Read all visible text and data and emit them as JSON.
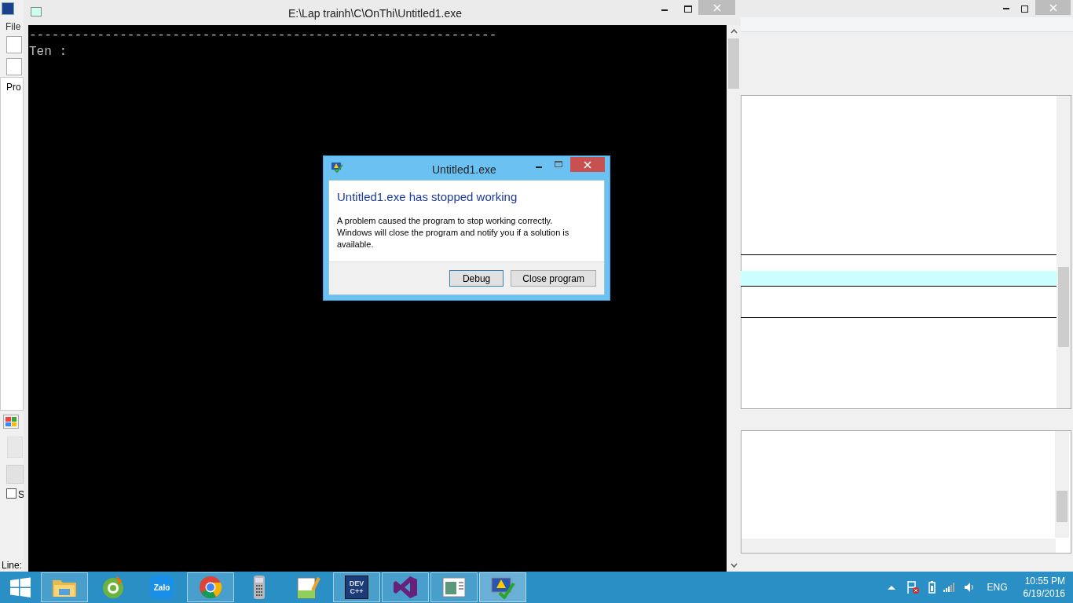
{
  "ide": {
    "menu": [
      "File"
    ],
    "panel_tab": "Pro",
    "checkbox_label": "S",
    "checkbox_checked": false,
    "status": "Line:"
  },
  "console": {
    "title": "E:\\Lap trainh\\C\\OnThi\\Untitled1.exe",
    "lines": [
      "--------------------------------------------------------------",
      "Ten :"
    ]
  },
  "dialog": {
    "title": "Untitled1.exe",
    "heading": "Untitled1.exe has stopped working",
    "message": "A problem caused the program to stop working correctly. Windows will close the program and notify you if a solution is available.",
    "buttons": [
      {
        "label": "Debug",
        "selected": true
      },
      {
        "label": "Close program",
        "selected": false
      }
    ]
  },
  "taskbar": {
    "apps": [
      {
        "kind": "folder",
        "running": true,
        "selected": false
      },
      {
        "kind": "browser-leaf",
        "running": false,
        "selected": false
      },
      {
        "kind": "chat",
        "label": "Zalo",
        "running": false,
        "selected": false
      },
      {
        "kind": "chrome",
        "running": true,
        "selected": false
      },
      {
        "kind": "calculator",
        "running": false,
        "selected": false
      },
      {
        "kind": "notepad",
        "running": false,
        "selected": false
      },
      {
        "kind": "ide",
        "label": "DEV C++",
        "running": true,
        "selected": false
      },
      {
        "kind": "studio",
        "running": true,
        "selected": false
      },
      {
        "kind": "window",
        "running": true,
        "selected": false
      },
      {
        "kind": "error-report",
        "running": true,
        "selected": true
      }
    ],
    "language": "ENG",
    "time": "10:55 PM",
    "date": "6/19/2016"
  }
}
